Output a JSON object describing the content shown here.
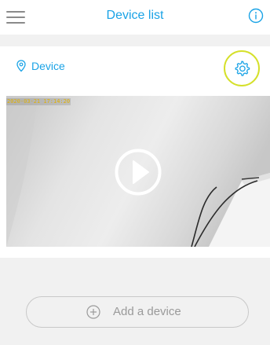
{
  "header": {
    "title": "Device list",
    "menu_icon": "hamburger-menu-icon",
    "info_icon": "info-icon"
  },
  "device": {
    "name": "Device",
    "location_icon": "location-pin-icon",
    "settings_icon": "gear-icon",
    "timestamp": "2020-03-21 17:14:20",
    "play_icon": "play-icon"
  },
  "actions": {
    "add_device_label": "Add a device",
    "add_icon": "plus-circle-icon"
  },
  "colors": {
    "accent": "#1aa3e6",
    "highlight_ring": "#d5e02a",
    "timestamp": "#e0b000",
    "muted_text": "#9a9a9a",
    "background": "#f1f1f1"
  }
}
